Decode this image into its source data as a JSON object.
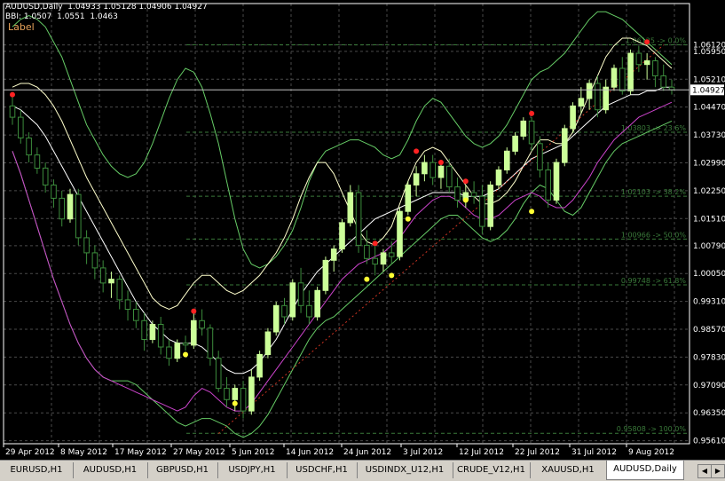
{
  "header": {
    "line1": "AUDUSD,Daily  1.04933 1.05128 1.04906 1.04927",
    "line2": "BBI: 1.0507  1.0551  1.0463",
    "label": "Label"
  },
  "colors": {
    "background": "#000000",
    "grid": "#4a4a4a",
    "bull_candle": "#ccff99",
    "bear_candle": "#1e6e1e",
    "upper_band": "#66cc66",
    "white_line": "#ffffff",
    "magenta": "#cc44cc",
    "yellow_line": "#ffffcc",
    "fib": "#3a7a3a",
    "trend": "#cc3322",
    "dot_red": "#ff2222",
    "dot_yellow": "#ffff33"
  },
  "chart_data": {
    "type": "candlestick",
    "ylim": [
      0.9553,
      1.0722
    ],
    "y_ticks": [
      "1.06120",
      "1.05950",
      "1.05210",
      "1.04470",
      "1.03730",
      "1.02990",
      "1.02250",
      "1.01510",
      "1.00790",
      "1.00050",
      "0.99310",
      "0.98570",
      "0.97830",
      "0.97090",
      "0.96350",
      "0.95610"
    ],
    "x_labels": [
      "29 Apr 2012",
      "8 May 2012",
      "17 May 2012",
      "27 May 2012",
      "5 Jun 2012",
      "14 Jun 2012",
      "24 Jun 2012",
      "3 Jul 2012",
      "12 Jul 2012",
      "22 Jul 2012",
      "31 Jul 2012",
      "9 Aug 2012"
    ],
    "current_price": "1.04927",
    "fib_levels": [
      {
        "label": "1.06125 -> 0.0%",
        "value": 1.06125
      },
      {
        "label": "1.03803 -> 23.6%",
        "value": 1.03803
      },
      {
        "label": "1.02103 -> 38.2%",
        "value": 1.02103
      },
      {
        "label": "1.00966 -> 50.0%",
        "value": 1.00966
      },
      {
        "label": "0.99748 -> 61.8%",
        "value": 0.99748
      },
      {
        "label": "0.95808 -> 100.0%",
        "value": 0.95808
      }
    ],
    "candles": [
      [
        1.045,
        1.0475,
        1.04,
        1.042
      ],
      [
        1.042,
        1.044,
        1.035,
        1.0365
      ],
      [
        1.0365,
        1.038,
        1.03,
        1.032
      ],
      [
        1.032,
        1.034,
        1.027,
        1.0285
      ],
      [
        1.0285,
        1.03,
        1.022,
        1.024
      ],
      [
        1.024,
        1.0255,
        1.018,
        1.0205
      ],
      [
        1.0205,
        1.0225,
        1.013,
        1.015
      ],
      [
        1.015,
        1.023,
        1.014,
        1.0215
      ],
      [
        1.0215,
        1.023,
        1.008,
        1.01
      ],
      [
        1.01,
        1.012,
        1.003,
        1.006
      ],
      [
        1.006,
        1.008,
        0.999,
        1.002
      ],
      [
        1.002,
        1.004,
        0.9955,
        0.998
      ],
      [
        0.998,
        1.001,
        0.994,
        0.999
      ],
      [
        0.999,
        1.0,
        0.991,
        0.9935
      ],
      [
        0.9935,
        0.996,
        0.988,
        0.991
      ],
      [
        0.991,
        0.993,
        0.986,
        0.988
      ],
      [
        0.988,
        0.99,
        0.98,
        0.983
      ],
      [
        0.983,
        0.988,
        0.982,
        0.987
      ],
      [
        0.987,
        0.989,
        0.979,
        0.981
      ],
      [
        0.981,
        0.983,
        0.976,
        0.978
      ],
      [
        0.978,
        0.983,
        0.977,
        0.982
      ],
      [
        0.982,
        0.984,
        0.98,
        0.9815
      ],
      [
        0.9815,
        0.99,
        0.9805,
        0.988
      ],
      [
        0.988,
        0.991,
        0.984,
        0.986
      ],
      [
        0.986,
        0.987,
        0.976,
        0.978
      ],
      [
        0.978,
        0.98,
        0.969,
        0.97
      ],
      [
        0.97,
        0.973,
        0.965,
        0.967
      ],
      [
        0.967,
        0.971,
        0.964,
        0.97
      ],
      [
        0.97,
        0.972,
        0.962,
        0.964
      ],
      [
        0.964,
        0.975,
        0.963,
        0.973
      ],
      [
        0.973,
        0.98,
        0.972,
        0.979
      ],
      [
        0.979,
        0.986,
        0.978,
        0.985
      ],
      [
        0.985,
        0.993,
        0.984,
        0.992
      ],
      [
        0.992,
        0.994,
        0.987,
        0.989
      ],
      [
        0.989,
        0.999,
        0.988,
        0.998
      ],
      [
        0.998,
        1.002,
        0.99,
        0.992
      ],
      [
        0.992,
        0.996,
        0.987,
        0.989
      ],
      [
        0.989,
        0.997,
        0.988,
        0.996
      ],
      [
        0.996,
        1.005,
        0.995,
        1.004
      ],
      [
        1.004,
        1.008,
        1.001,
        1.007
      ],
      [
        1.007,
        1.015,
        1.006,
        1.014
      ],
      [
        1.014,
        1.024,
        1.013,
        1.022
      ],
      [
        1.022,
        1.024,
        1.006,
        1.008
      ],
      [
        1.008,
        1.012,
        1.003,
        1.0045
      ],
      [
        1.0045,
        1.008,
        1.0,
        1.003
      ],
      [
        1.003,
        1.007,
        1.001,
        1.006
      ],
      [
        1.006,
        1.009,
        1.003,
        1.005
      ],
      [
        1.005,
        1.018,
        1.004,
        1.017
      ],
      [
        1.017,
        1.025,
        1.016,
        1.024
      ],
      [
        1.024,
        1.029,
        1.021,
        1.027
      ],
      [
        1.027,
        1.032,
        1.025,
        1.03
      ],
      [
        1.03,
        1.032,
        1.024,
        1.026
      ],
      [
        1.026,
        1.03,
        1.023,
        1.029
      ],
      [
        1.029,
        1.031,
        1.022,
        1.0235
      ],
      [
        1.0235,
        1.026,
        1.018,
        1.02
      ],
      [
        1.02,
        1.024,
        1.018,
        1.022
      ],
      [
        1.022,
        1.025,
        1.019,
        1.021
      ],
      [
        1.021,
        1.024,
        1.011,
        1.013
      ],
      [
        1.013,
        1.025,
        1.012,
        1.024
      ],
      [
        1.024,
        1.029,
        1.023,
        1.028
      ],
      [
        1.028,
        1.034,
        1.027,
        1.033
      ],
      [
        1.033,
        1.038,
        1.032,
        1.037
      ],
      [
        1.037,
        1.042,
        1.036,
        1.041
      ],
      [
        1.041,
        1.042,
        1.033,
        1.035
      ],
      [
        1.035,
        1.037,
        1.026,
        1.028
      ],
      [
        1.028,
        1.03,
        1.018,
        1.02
      ],
      [
        1.02,
        1.031,
        1.019,
        1.03
      ],
      [
        1.03,
        1.04,
        1.029,
        1.039
      ],
      [
        1.039,
        1.046,
        1.038,
        1.045
      ],
      [
        1.045,
        1.05,
        1.043,
        1.047
      ],
      [
        1.047,
        1.052,
        1.044,
        1.051
      ],
      [
        1.051,
        1.053,
        1.042,
        1.044
      ],
      [
        1.044,
        1.052,
        1.043,
        1.05
      ],
      [
        1.05,
        1.056,
        1.049,
        1.055
      ],
      [
        1.055,
        1.058,
        1.048,
        1.049
      ],
      [
        1.049,
        1.06,
        1.048,
        1.059
      ],
      [
        1.059,
        1.061,
        1.054,
        1.056
      ],
      [
        1.056,
        1.059,
        1.052,
        1.057
      ],
      [
        1.057,
        1.058,
        1.05,
        1.053
      ],
      [
        1.053,
        1.056,
        1.049,
        1.05
      ],
      [
        1.05,
        1.052,
        1.048,
        1.0493
      ]
    ],
    "upper_band": [
      1.066,
      1.068,
      1.069,
      1.068,
      1.066,
      1.062,
      1.058,
      1.052,
      1.046,
      1.04,
      1.036,
      1.032,
      1.029,
      1.027,
      1.026,
      1.027,
      1.03,
      1.035,
      1.041,
      1.047,
      1.052,
      1.055,
      1.054,
      1.05,
      1.043,
      1.035,
      1.025,
      1.015,
      1.007,
      1.003,
      1.002,
      1.003,
      1.005,
      1.008,
      1.012,
      1.018,
      1.025,
      1.03,
      1.033,
      1.034,
      1.035,
      1.036,
      1.036,
      1.035,
      1.034,
      1.032,
      1.031,
      1.032,
      1.036,
      1.041,
      1.045,
      1.047,
      1.046,
      1.043,
      1.04,
      1.037,
      1.035,
      1.034,
      1.035,
      1.037,
      1.04,
      1.044,
      1.048,
      1.052,
      1.054,
      1.055,
      1.057,
      1.059,
      1.062,
      1.065,
      1.068,
      1.07,
      1.07,
      1.069,
      1.068,
      1.066,
      1.064,
      1.062,
      1.06,
      1.058,
      1.056
    ],
    "upper_inner": [
      1.05,
      1.051,
      1.051,
      1.05,
      1.048,
      1.045,
      1.041,
      1.036,
      1.031,
      1.026,
      1.022,
      1.018,
      1.014,
      1.01,
      1.006,
      1.002,
      0.998,
      0.994,
      0.992,
      0.991,
      0.992,
      0.995,
      0.998,
      1.0,
      1.0,
      0.998,
      0.996,
      0.995,
      0.996,
      0.998,
      1.0,
      1.003,
      1.006,
      1.01,
      1.015,
      1.021,
      1.026,
      1.03,
      1.03,
      1.027,
      1.022,
      1.017,
      1.012,
      1.009,
      1.008,
      1.01,
      1.013,
      1.019,
      1.025,
      1.03,
      1.033,
      1.034,
      1.033,
      1.03,
      1.027,
      1.024,
      1.021,
      1.019,
      1.019,
      1.02,
      1.022,
      1.025,
      1.029,
      1.033,
      1.036,
      1.036,
      1.035,
      1.035,
      1.038,
      1.043,
      1.048,
      1.053,
      1.058,
      1.061,
      1.063,
      1.063,
      1.062,
      1.061,
      1.059,
      1.057,
      1.055
    ],
    "mid_line": [
      1.045,
      1.044,
      1.042,
      1.04,
      1.037,
      1.033,
      1.029,
      1.025,
      1.021,
      1.017,
      1.013,
      1.009,
      1.005,
      1.001,
      0.997,
      0.993,
      0.99,
      0.987,
      0.985,
      0.983,
      0.982,
      0.982,
      0.982,
      0.981,
      0.979,
      0.977,
      0.975,
      0.974,
      0.974,
      0.975,
      0.977,
      0.98,
      0.983,
      0.987,
      0.991,
      0.995,
      0.998,
      1.001,
      1.003,
      1.005,
      1.007,
      1.009,
      1.011,
      1.013,
      1.015,
      1.016,
      1.017,
      1.018,
      1.019,
      1.02,
      1.021,
      1.022,
      1.022,
      1.022,
      1.022,
      1.021,
      1.021,
      1.021,
      1.022,
      1.023,
      1.025,
      1.027,
      1.029,
      1.031,
      1.032,
      1.033,
      1.034,
      1.035,
      1.037,
      1.039,
      1.041,
      1.043,
      1.045,
      1.046,
      1.047,
      1.048,
      1.048,
      1.049,
      1.049,
      1.05,
      1.05
    ],
    "lower_band": [
      1.033,
      1.027,
      1.02,
      1.013,
      1.006,
      0.999,
      0.993,
      0.987,
      0.982,
      0.978,
      0.975,
      0.973,
      0.972,
      0.972,
      0.972,
      0.971,
      0.969,
      0.967,
      0.965,
      0.963,
      0.961,
      0.96,
      0.961,
      0.962,
      0.962,
      0.961,
      0.96,
      0.958,
      0.957,
      0.958,
      0.96,
      0.963,
      0.967,
      0.971,
      0.975,
      0.979,
      0.983,
      0.986,
      0.988,
      0.989,
      0.991,
      0.993,
      0.995,
      0.997,
      0.999,
      1.001,
      1.003,
      1.005,
      1.007,
      1.009,
      1.011,
      1.013,
      1.015,
      1.016,
      1.016,
      1.014,
      1.012,
      1.01,
      1.009,
      1.01,
      1.012,
      1.015,
      1.019,
      1.022,
      1.024,
      1.023,
      1.02,
      1.017,
      1.016,
      1.018,
      1.022,
      1.026,
      1.03,
      1.033,
      1.035,
      1.036,
      1.037,
      1.038,
      1.039,
      1.04,
      1.041
    ],
    "magenta_line": [
      1.033,
      1.027,
      1.02,
      1.013,
      1.006,
      0.999,
      0.993,
      0.987,
      0.982,
      0.978,
      0.975,
      0.973,
      0.972,
      0.971,
      0.97,
      0.969,
      0.968,
      0.967,
      0.966,
      0.965,
      0.964,
      0.965,
      0.968,
      0.97,
      0.969,
      0.967,
      0.965,
      0.964,
      0.964,
      0.966,
      0.969,
      0.972,
      0.975,
      0.978,
      0.981,
      0.984,
      0.987,
      0.99,
      0.993,
      0.996,
      0.999,
      1.001,
      1.003,
      1.004,
      1.005,
      1.006,
      1.008,
      1.01,
      1.013,
      1.016,
      1.018,
      1.02,
      1.021,
      1.021,
      1.02,
      1.018,
      1.016,
      1.015,
      1.015,
      1.016,
      1.018,
      1.02,
      1.021,
      1.022,
      1.021,
      1.019,
      1.018,
      1.018,
      1.02,
      1.023,
      1.026,
      1.03,
      1.033,
      1.036,
      1.038,
      1.04,
      1.042,
      1.043,
      1.044,
      1.045,
      1.046
    ],
    "trend_line": [
      [
        25,
        0.958
      ],
      [
        79,
        1.0612
      ]
    ],
    "red_dots": [
      [
        0,
        1.048
      ],
      [
        22,
        0.9905
      ],
      [
        44,
        1.0085
      ],
      [
        49,
        1.033
      ],
      [
        52,
        1.03
      ],
      [
        55,
        1.025
      ],
      [
        63,
        1.043
      ],
      [
        77,
        1.062
      ]
    ],
    "yellow_dots": [
      [
        21,
        0.979
      ],
      [
        27,
        0.966
      ],
      [
        43,
        0.999
      ],
      [
        46,
        1.0
      ],
      [
        48,
        1.015
      ],
      [
        55,
        1.02
      ],
      [
        63,
        1.017
      ]
    ]
  },
  "tabs": [
    {
      "label": "EURUSD,H1",
      "active": false
    },
    {
      "label": "AUDUSD,H1",
      "active": false
    },
    {
      "label": "GBPUSD,H1",
      "active": false
    },
    {
      "label": "USDJPY,H1",
      "active": false
    },
    {
      "label": "USDCHF,H1",
      "active": false
    },
    {
      "label": "USDINDX_U12,H1",
      "active": false
    },
    {
      "label": "CRUDE_V12,H1",
      "active": false
    },
    {
      "label": "XAUUSD,H1",
      "active": false
    },
    {
      "label": "AUDUSD,Daily",
      "active": true
    }
  ]
}
